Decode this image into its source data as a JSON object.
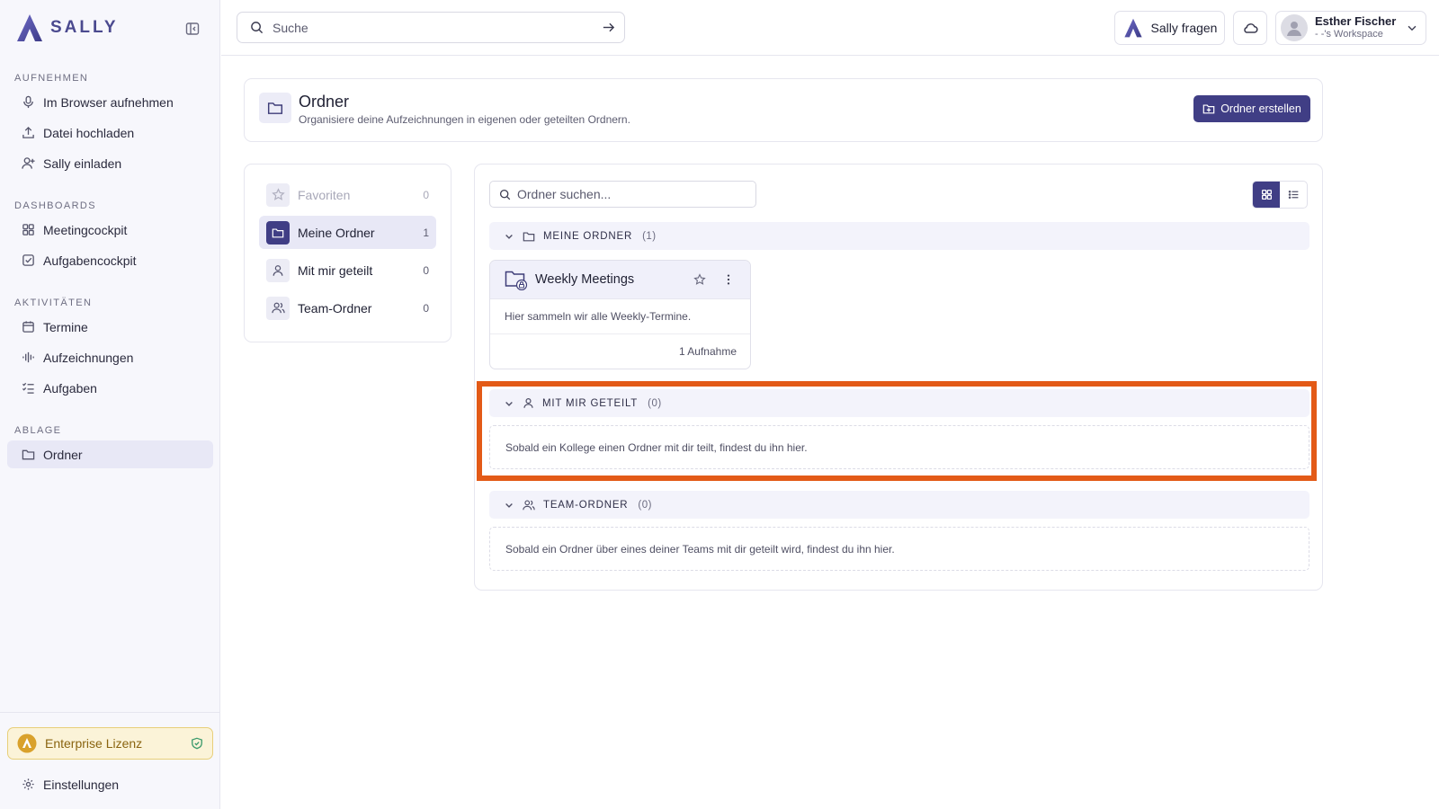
{
  "brand": {
    "name": "SALLY",
    "accent": "#403e85"
  },
  "sidebar": {
    "sections": [
      {
        "title": "AUFNEHMEN"
      },
      {
        "title": "DASHBOARDS"
      },
      {
        "title": "AKTIVITÄTEN"
      },
      {
        "title": "ABLAGE"
      }
    ],
    "items": [
      {
        "label": "Im Browser aufnehmen",
        "icon": "microphone-icon"
      },
      {
        "label": "Datei hochladen",
        "icon": "upload-icon"
      },
      {
        "label": "Sally einladen",
        "icon": "user-plus-icon"
      },
      {
        "label": "Meetingcockpit",
        "icon": "grid-icon"
      },
      {
        "label": "Aufgabencockpit",
        "icon": "check-square-icon"
      },
      {
        "label": "Termine",
        "icon": "calendar-icon"
      },
      {
        "label": "Aufzeichnungen",
        "icon": "audio-wave-icon"
      },
      {
        "label": "Aufgaben",
        "icon": "task-list-icon"
      },
      {
        "label": "Ordner",
        "icon": "folder-icon",
        "active": true
      }
    ],
    "license": {
      "label": "Enterprise Lizenz",
      "color": "#e8cf7a"
    },
    "settings": {
      "label": "Einstellungen",
      "icon": "gear-icon"
    }
  },
  "topbar": {
    "search": {
      "placeholder": "Suche",
      "value": ""
    },
    "ask_button": "Sally fragen",
    "user": {
      "name": "Esther Fischer",
      "workspace": "- -'s Workspace"
    }
  },
  "page": {
    "title": "Ordner",
    "subtitle": "Organisiere deine Aufzeichnungen in eigenen oder geteilten Ordnern.",
    "create_button": "Ordner erstellen"
  },
  "filters": [
    {
      "label": "Favoriten",
      "count": "0",
      "icon": "star-icon",
      "muted": true
    },
    {
      "label": "Meine Ordner",
      "count": "1",
      "icon": "folder-icon",
      "active": true
    },
    {
      "label": "Mit mir geteilt",
      "count": "0",
      "icon": "user-icon"
    },
    {
      "label": "Team-Ordner",
      "count": "0",
      "icon": "users-icon"
    }
  ],
  "main": {
    "folder_search": {
      "placeholder": "Ordner suchen...",
      "value": ""
    },
    "view": "grid",
    "groups": [
      {
        "title": "MEINE ORDNER",
        "count": "(1)",
        "folders": [
          {
            "name": "Weekly Meetings",
            "description": "Hier sammeln wir alle Weekly-Termine.",
            "recordings": "1 Aufnahme"
          }
        ]
      },
      {
        "title": "MIT MIR GETEILT",
        "count": "(0)",
        "empty_text": "Sobald ein Kollege einen Ordner mit dir teilt, findest du ihn hier."
      },
      {
        "title": "TEAM-ORDNER",
        "count": "(0)",
        "empty_text": "Sobald ein Ordner über eines deiner Teams mit dir geteilt wird, findest du ihn hier."
      }
    ]
  },
  "highlight_color": "#e35a17"
}
